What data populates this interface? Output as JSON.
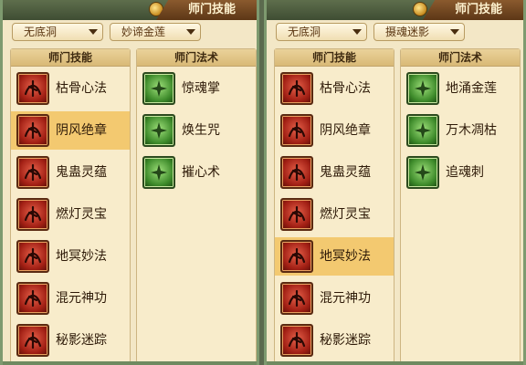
{
  "left": {
    "title": "师门技能",
    "dropdown1": "无底洞",
    "dropdown2": "妙谛金莲",
    "skills_header": "师门技能",
    "spells_header": "师门法术",
    "skills": [
      {
        "name": "枯骨心法",
        "icon": "skull-figure-icon",
        "selected": false
      },
      {
        "name": "阴风绝章",
        "icon": "wind-scroll-icon",
        "selected": true
      },
      {
        "name": "鬼蛊灵蕴",
        "icon": "scorpion-icon",
        "selected": false
      },
      {
        "name": "燃灯灵宝",
        "icon": "lantern-coin-icon",
        "selected": false
      },
      {
        "name": "地冥妙法",
        "icon": "mushroom-cloud-icon",
        "selected": false
      },
      {
        "name": "混元神功",
        "icon": "coiled-dragon-icon",
        "selected": false
      },
      {
        "name": "秘影迷踪",
        "icon": "swirl-shadow-icon",
        "selected": false
      }
    ],
    "spells": [
      {
        "name": "惊魂掌",
        "icon": "palm-icon"
      },
      {
        "name": "焕生咒",
        "icon": "glowing-figure-icon"
      },
      {
        "name": "摧心术",
        "icon": "fighters-icon"
      }
    ]
  },
  "right": {
    "title": "师门技能",
    "dropdown1": "无底洞",
    "dropdown2": "摄魂迷影",
    "skills_header": "师门技能",
    "spells_header": "师门法术",
    "skills": [
      {
        "name": "枯骨心法",
        "icon": "skull-figure-icon",
        "selected": false
      },
      {
        "name": "阴风绝章",
        "icon": "wind-scroll-icon",
        "selected": false
      },
      {
        "name": "鬼蛊灵蕴",
        "icon": "scorpion-icon",
        "selected": false
      },
      {
        "name": "燃灯灵宝",
        "icon": "lantern-coin-icon",
        "selected": false
      },
      {
        "name": "地冥妙法",
        "icon": "mushroom-cloud-icon",
        "selected": true
      },
      {
        "name": "混元神功",
        "icon": "coiled-dragon-icon",
        "selected": false
      },
      {
        "name": "秘影迷踪",
        "icon": "swirl-shadow-icon",
        "selected": false
      }
    ],
    "spells": [
      {
        "name": "地涌金莲",
        "icon": "lotus-icon"
      },
      {
        "name": "万木凋枯",
        "icon": "withered-tree-icon"
      },
      {
        "name": "追魂刺",
        "icon": "heart-thorn-icon"
      }
    ]
  },
  "colors": {
    "panel_bg": "#f3e7c6",
    "selected_bg": "#f3c970",
    "skill_icon_red": "#a11f14",
    "spell_icon_green": "#3d8a2a"
  }
}
